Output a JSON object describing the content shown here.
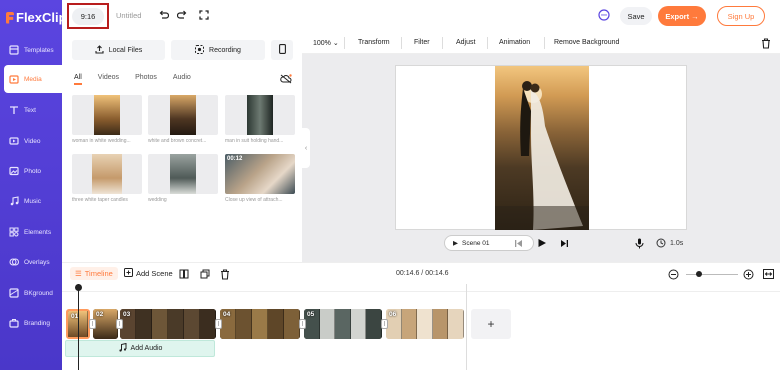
{
  "app": {
    "logo_text": "FlexClip",
    "aspect_ratio": "9:16",
    "project_title": "Untitled",
    "save_label": "Save",
    "export_label": "Export →",
    "signup_label": "Sign Up"
  },
  "sidebar": {
    "items": [
      {
        "label": "Templates",
        "icon": "templates-icon"
      },
      {
        "label": "Media",
        "icon": "media-icon"
      },
      {
        "label": "Text",
        "icon": "text-icon"
      },
      {
        "label": "Video",
        "icon": "video-icon"
      },
      {
        "label": "Photo",
        "icon": "photo-icon"
      },
      {
        "label": "Music",
        "icon": "music-icon"
      },
      {
        "label": "Elements",
        "icon": "elements-icon"
      },
      {
        "label": "Overlays",
        "icon": "overlays-icon"
      },
      {
        "label": "BKground",
        "icon": "background-icon"
      },
      {
        "label": "Branding",
        "icon": "branding-icon"
      }
    ],
    "active": "Media"
  },
  "media_panel": {
    "local_files_label": "Local Files",
    "recording_label": "Recording",
    "tabs": [
      "All",
      "Videos",
      "Photos",
      "Audio"
    ],
    "active_tab": "All",
    "thumbnails": [
      {
        "caption": "woman in white wedding...",
        "duration": ""
      },
      {
        "caption": "white and brown concret...",
        "duration": ""
      },
      {
        "caption": "man in suit holding hand...",
        "duration": ""
      },
      {
        "caption": "three white taper candles",
        "duration": ""
      },
      {
        "caption": "wedding",
        "duration": ""
      },
      {
        "caption": "Close up view of attrach...",
        "duration": "00:12"
      }
    ]
  },
  "edit_bar": {
    "zoom": "100%",
    "items": [
      "Transform",
      "Filter",
      "Adjust",
      "Animation",
      "Remove Background"
    ]
  },
  "preview": {
    "scene_label": "Scene 01",
    "duration": "1.0s"
  },
  "timeline": {
    "timeline_label": "Timeline",
    "add_scene_label": "Add Scene",
    "time_readout": "00:14.6 / 00:14.6",
    "zoom_level": 0.25,
    "clips": [
      "01",
      "02",
      "03",
      "04",
      "05",
      "06"
    ],
    "add_audio_label": "Add Audio",
    "add_clip_symbol": "+"
  },
  "colors": {
    "accent": "#ff7a3c",
    "sidebar": "#5b45e0",
    "highlight_border": "#b81d1d"
  }
}
